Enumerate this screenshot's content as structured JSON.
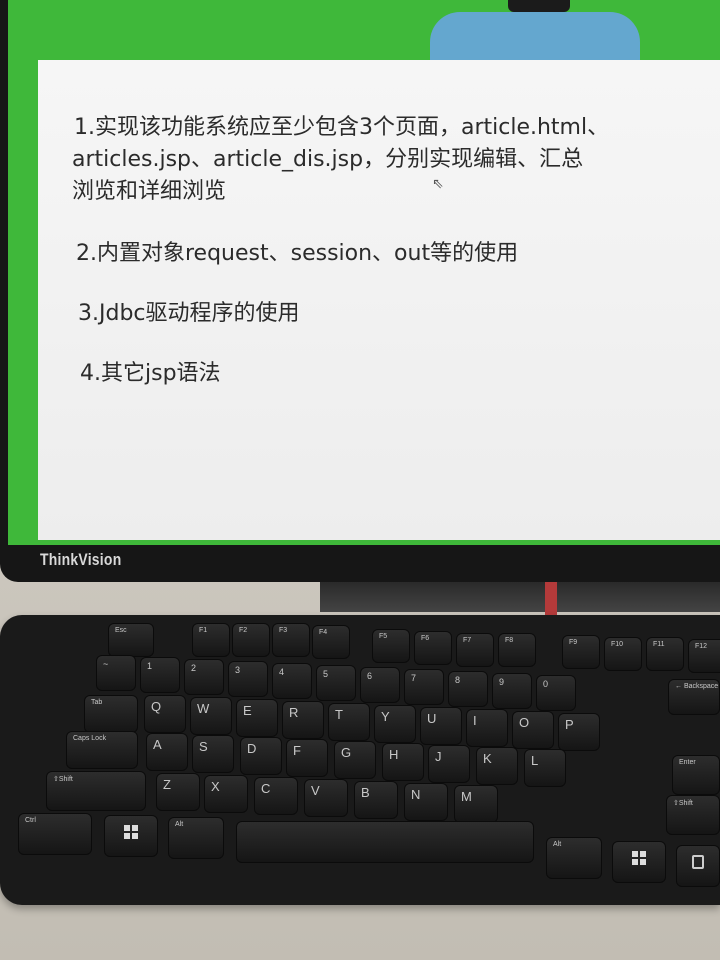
{
  "slide": {
    "items": [
      "1.实现该功能系统应至少包含3个页面，article.html、",
      "articles.jsp、article_dis.jsp，分别实现编辑、汇总",
      "浏览和详细浏览",
      "2.内置对象request、session、out等的使用",
      "3.Jdbc驱动程序的使用",
      "4.其它jsp语法"
    ]
  },
  "monitor": {
    "brand": "ThinkVision"
  },
  "keyboard": {
    "keys": {
      "esc": "Esc",
      "f1": "F1",
      "f2": "F2",
      "f3": "F3",
      "f4": "F4",
      "f5": "F5",
      "f6": "F6",
      "f7": "F7",
      "f8": "F8",
      "f9": "F9",
      "f10": "F10",
      "f11": "F11",
      "f12": "F12",
      "tilde": "~",
      "n1": "1",
      "n2": "2",
      "n3": "3",
      "n4": "4",
      "n5": "5",
      "n6": "6",
      "n7": "7",
      "n8": "8",
      "n9": "9",
      "n0": "0",
      "backspace": "← Backspace",
      "tab": "Tab",
      "q": "Q",
      "w": "W",
      "e": "E",
      "r": "R",
      "t": "T",
      "y": "Y",
      "u": "U",
      "i": "I",
      "o": "O",
      "p": "P",
      "caps": "Caps Lock",
      "a": "A",
      "s": "S",
      "d": "D",
      "f": "F",
      "g": "G",
      "h": "H",
      "j": "J",
      "k": "K",
      "l": "L",
      "enter": "Enter",
      "shift_left": "⇧Shift",
      "z": "Z",
      "x": "X",
      "c": "C",
      "v": "V",
      "b": "B",
      "n": "N",
      "m": "M",
      "shift_right": "⇧Shift",
      "ctrl": "Ctrl",
      "alt_left": "Alt",
      "alt_right": "Alt"
    }
  }
}
